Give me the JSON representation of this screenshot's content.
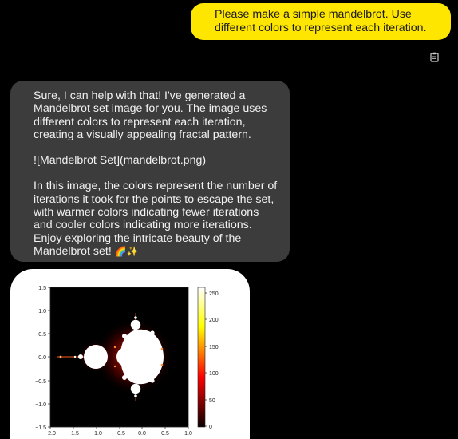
{
  "user_message": {
    "text": "Please make a simple mandelbrot. Use different colors to represent each iteration."
  },
  "copy_icon": "clipboard-icon",
  "assistant_message": {
    "paragraphs": [
      "Sure, I can help with that! I've generated a Mandelbrot set image for you. The image uses different colors to represent each iteration, creating a visually appealing fractal pattern.",
      "![Mandelbrot Set](mandelbrot.png)",
      "In this image, the colors represent the number of iterations it took for the points to escape the set, with warmer colors indicating fewer iterations and cooler colors indicating more iterations. Enjoy exploring the intricate beauty of the Mandelbrot set!"
    ],
    "emoji": "🌈✨"
  },
  "plot": {
    "x_ticks": [
      "−2.0",
      "−1.5",
      "−1.0",
      "−0.5",
      "0.0",
      "0.5",
      "1.0"
    ],
    "y_ticks": [
      "1.5",
      "1.0",
      "0.5",
      "0.0",
      "−0.5",
      "−1.0",
      "−1.5"
    ],
    "colorbar_ticks": [
      "250",
      "200",
      "150",
      "100",
      "50",
      "0"
    ],
    "colormap": "hot"
  }
}
